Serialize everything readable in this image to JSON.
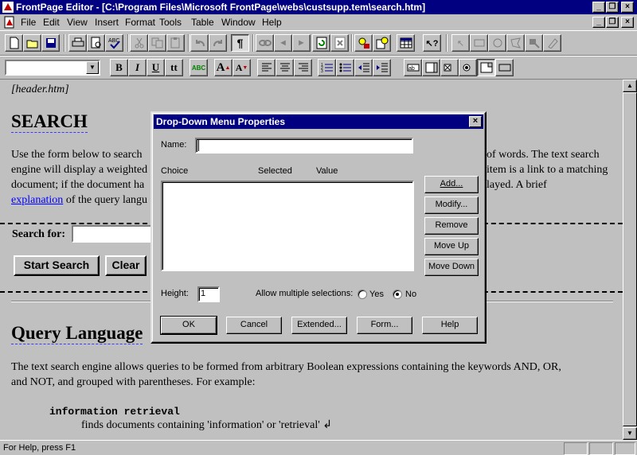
{
  "window": {
    "title": "FrontPage Editor - [C:\\Program Files\\Microsoft FrontPage\\webs\\custsupp.tem\\search.htm]",
    "minimize": "_",
    "restore": "❐",
    "close": "×"
  },
  "menu": [
    "File",
    "Edit",
    "View",
    "Insert",
    "Format",
    "Tools",
    "Table",
    "Window",
    "Help"
  ],
  "format_toolbar": {
    "bold": "B",
    "italic": "I",
    "underline": "U",
    "typewriter": "tt",
    "font_color": "ABC",
    "increase_size": "A",
    "decrease_size": "A"
  },
  "document": {
    "include_header": "[header.htm]",
    "heading": "SEARCH",
    "intro_line1_left": "Use the form below to search",
    "intro_line1_right": "of words. The text search",
    "intro_line2_left": "engine will display a weighted",
    "intro_line2_right": "item is a link to a matching",
    "intro_line3_left": "document; if the document ha",
    "intro_line3_right": "layed. A brief",
    "intro_link": "explanation",
    "intro_line4_rest": "of the query langu",
    "search_label": "Search for:",
    "start_button": "Start Search",
    "clear_button": "Clear",
    "query_heading": "Query Language",
    "query_text1": "The text search engine allows queries to be formed from arbitrary Boolean expressions containing the keywords AND, OR,",
    "query_text2": "and NOT, and grouped with parentheses. For example:",
    "example_term": "information retrieval",
    "example_desc": "finds documents containing 'information' or 'retrieval'",
    "line_break_mark": "↲"
  },
  "dialog": {
    "title": "Drop-Down Menu Properties",
    "close": "×",
    "name_label": "Name:",
    "name_value": "",
    "col_choice": "Choice",
    "col_selected": "Selected",
    "col_value": "Value",
    "buttons_side": [
      "Add...",
      "Modify...",
      "Remove",
      "Move Up",
      "Move Down"
    ],
    "height_label": "Height:",
    "height_value": "1",
    "multi_label": "Allow multiple selections:",
    "yes_label": "Yes",
    "no_label": "No",
    "multi_selected": "No",
    "ok": "OK",
    "cancel": "Cancel",
    "extended": "Extended...",
    "form": "Form...",
    "help": "Help"
  },
  "status": {
    "text": "For Help, press F1"
  }
}
